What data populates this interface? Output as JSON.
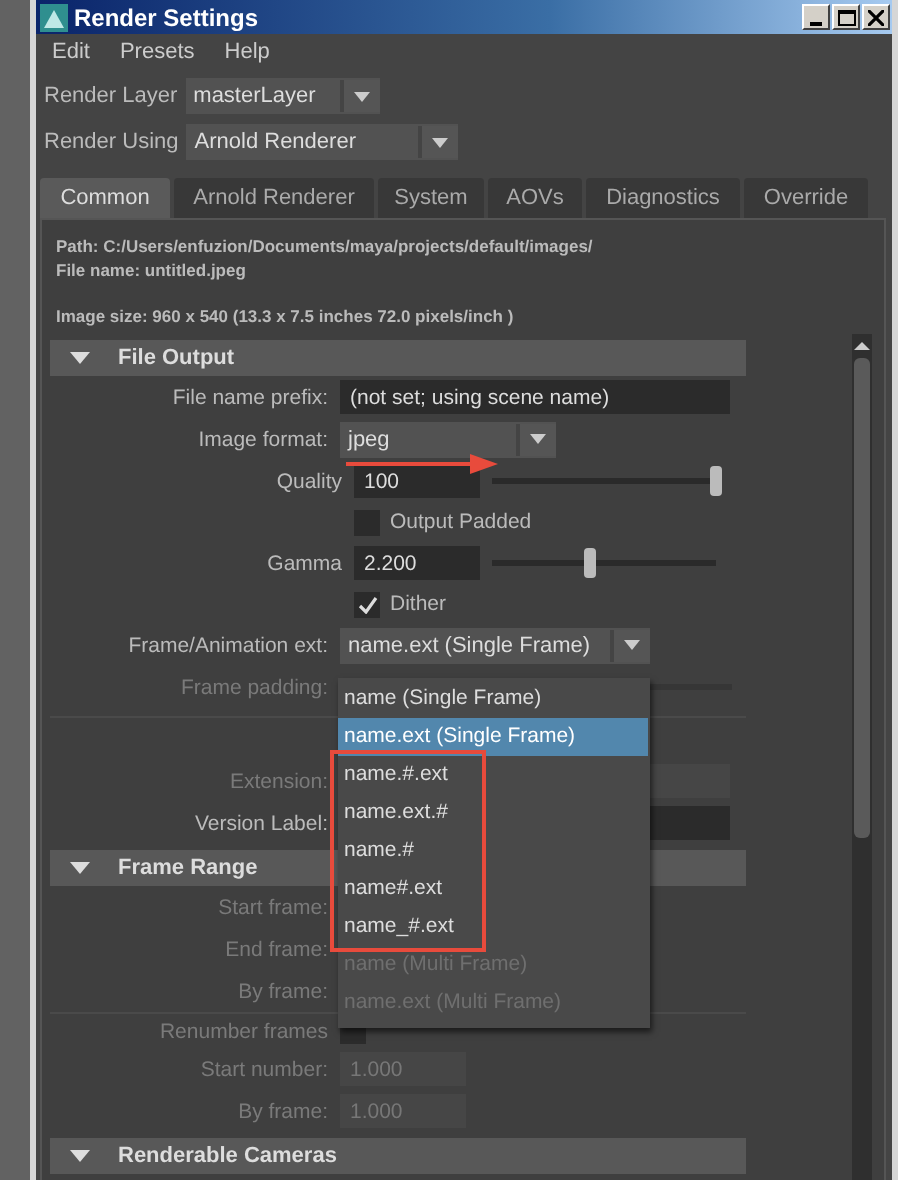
{
  "window": {
    "title": "Render Settings"
  },
  "menu": [
    "Edit",
    "Presets",
    "Help"
  ],
  "render_layer": {
    "label": "Render Layer",
    "value": "masterLayer"
  },
  "render_using": {
    "label": "Render Using",
    "value": "Arnold Renderer"
  },
  "tabs": [
    {
      "label": "Common",
      "selected": true
    },
    {
      "label": "Arnold Renderer",
      "selected": false
    },
    {
      "label": "System",
      "selected": false
    },
    {
      "label": "AOVs",
      "selected": false
    },
    {
      "label": "Diagnostics",
      "selected": false
    },
    {
      "label": "Override",
      "selected": false
    }
  ],
  "info": {
    "path": "Path: C:/Users/enfuzion/Documents/maya/projects/default/images/",
    "file_name": "File name:  untitled.jpeg",
    "image_size": "Image size: 960 x 540 (13.3 x 7.5 inches 72.0 pixels/inch )"
  },
  "sections": [
    {
      "title": "File Output",
      "expanded": true,
      "rows": [
        {
          "kind": "field",
          "label": "File name prefix:",
          "placeholder": "(not set; using scene name)",
          "disabled": false
        },
        {
          "kind": "dropdown",
          "label": "Image format:",
          "value": "jpeg",
          "annotated": true
        },
        {
          "kind": "slider",
          "label": "Quality",
          "value": "100",
          "level": 1.0
        },
        {
          "kind": "checkbox",
          "label": "Output Padded",
          "checked": false,
          "disabled": false
        },
        {
          "kind": "slider",
          "label": "Gamma",
          "value": "2.200",
          "level": 0.44
        },
        {
          "kind": "checkbox",
          "label": "Dither",
          "checked": true,
          "disabled": false
        },
        {
          "kind": "dropdown",
          "label": "Frame/Animation ext:",
          "value": "name.ext (Single Frame)",
          "open": true
        },
        {
          "kind": "covered-slider",
          "label": "Frame padding:",
          "disabled": true
        },
        {
          "kind": "separator"
        },
        {
          "kind": "covered-field",
          "label": "Extension:",
          "disabled": true
        },
        {
          "kind": "covered-field",
          "label": "Version Label:",
          "disabled": false
        }
      ]
    },
    {
      "title": "Frame Range",
      "expanded": true,
      "rows": [
        {
          "kind": "covered",
          "label": "Start frame:",
          "disabled": true
        },
        {
          "kind": "covered",
          "label": "End frame:",
          "disabled": true
        },
        {
          "kind": "covered",
          "label": "By frame:",
          "disabled": true
        },
        {
          "kind": "separator"
        },
        {
          "kind": "checkbox",
          "label": "Renumber frames",
          "checked": false,
          "disabled": true
        },
        {
          "kind": "field",
          "label": "Start number:",
          "value": "1.000",
          "disabled": true
        },
        {
          "kind": "field",
          "label": "By frame:",
          "value": "1.000",
          "disabled": true
        }
      ]
    },
    {
      "title": "Renderable Cameras",
      "expanded": true
    }
  ],
  "popup": {
    "groups": [
      {
        "boxed": false,
        "items": [
          {
            "label": "name (Single Frame)",
            "selected": false,
            "disabled": false
          },
          {
            "label": "name.ext (Single Frame)",
            "selected": true,
            "disabled": false
          }
        ]
      },
      {
        "boxed": true,
        "items": [
          {
            "label": "name.#.ext",
            "selected": false,
            "disabled": false
          },
          {
            "label": "name.ext.#",
            "selected": false,
            "disabled": false
          },
          {
            "label": "name.#",
            "selected": false,
            "disabled": false
          },
          {
            "label": "name#.ext",
            "selected": false,
            "disabled": false
          },
          {
            "label": "name_#.ext",
            "selected": false,
            "disabled": false
          }
        ]
      },
      {
        "boxed": false,
        "items": [
          {
            "label": "name (Multi Frame)",
            "selected": false,
            "disabled": true
          },
          {
            "label": "name.ext (Multi Frame)",
            "selected": false,
            "disabled": true
          }
        ]
      }
    ]
  }
}
